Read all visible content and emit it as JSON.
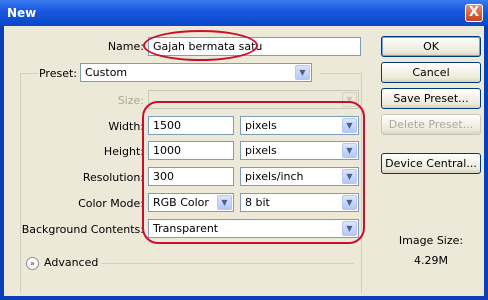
{
  "window": {
    "title": "New",
    "close_glyph": "X"
  },
  "form": {
    "name_label": "Name:",
    "name_value": "Gajah bermata satu",
    "preset_label": "Preset:",
    "preset_value": "Custom",
    "size_label": "Size:",
    "size_value": "",
    "width_label": "Width:",
    "width_value": "1500",
    "width_unit": "pixels",
    "height_label": "Height:",
    "height_value": "1000",
    "height_unit": "pixels",
    "resolution_label": "Resolution:",
    "resolution_value": "300",
    "resolution_unit": "pixels/inch",
    "color_mode_label": "Color Mode:",
    "color_mode_value": "RGB Color",
    "bit_depth_value": "8 bit",
    "background_label": "Background Contents:",
    "background_value": "Transparent",
    "advanced_label": "Advanced"
  },
  "buttons": {
    "ok": "OK",
    "cancel": "Cancel",
    "save_preset": "Save Preset...",
    "delete_preset": "Delete Preset...",
    "device_central": "Device Central..."
  },
  "info": {
    "image_size_label": "Image Size:",
    "image_size_value": "4.29M"
  },
  "icons": {
    "dropdown_arrow": "chevron-down-icon",
    "advanced_toggle": "double-chevron-down-icon",
    "close": "close-icon"
  },
  "colors": {
    "title_bar": "#1a59e0",
    "dialog_bg": "#ece9d8",
    "annotation": "#c8102e"
  }
}
